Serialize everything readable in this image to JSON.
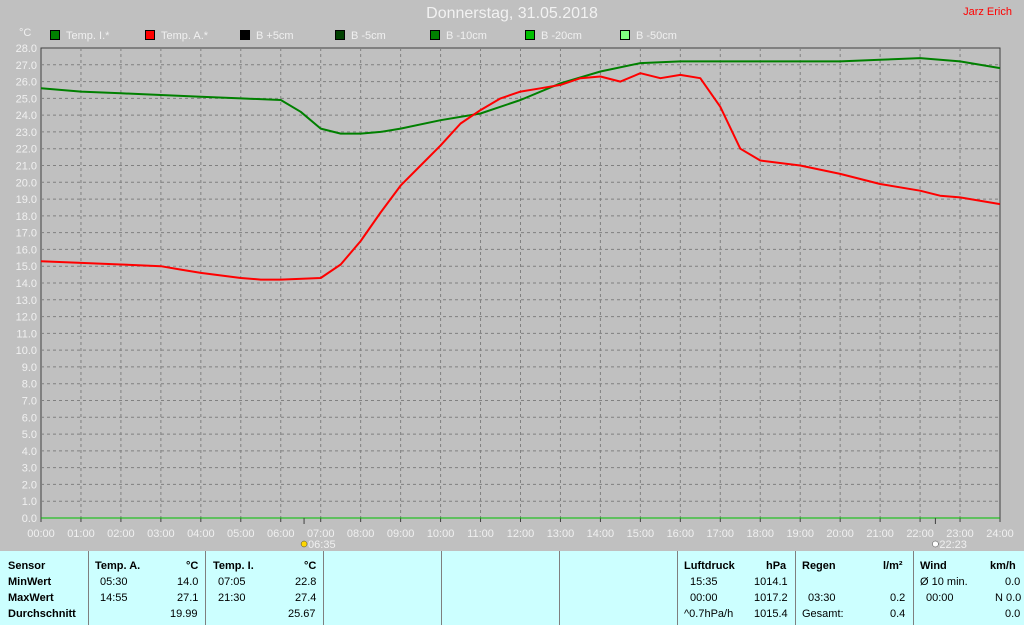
{
  "header": {
    "title": "Donnerstag, 31.05.2018",
    "author": "Jarz Erich",
    "y_unit": "°C"
  },
  "legend": [
    {
      "label": "Temp. I.*",
      "color": "#008000"
    },
    {
      "label": "Temp. A.*",
      "color": "#ff0000"
    },
    {
      "label": "B +5cm",
      "color": "#000000"
    },
    {
      "label": "B -5cm",
      "color": "#004000"
    },
    {
      "label": "B -10cm",
      "color": "#008000"
    },
    {
      "label": "B -20cm",
      "color": "#00c000"
    },
    {
      "label": "B -50cm",
      "color": "#80ff80"
    }
  ],
  "markers": {
    "sunrise": "06:35",
    "sunset": "22:23"
  },
  "colors": {
    "background": "#c0c0c0",
    "table_bg": "#ccffff",
    "grid": "#808080"
  },
  "chart_data": {
    "type": "line",
    "title": "Donnerstag, 31.05.2018",
    "ylabel": "°C",
    "ylim": [
      0,
      28
    ],
    "xlim": [
      0,
      24
    ],
    "grid": true,
    "legend_position": "top",
    "y_ticks": [
      "0.0",
      "1.0",
      "2.0",
      "3.0",
      "4.0",
      "5.0",
      "6.0",
      "7.0",
      "8.0",
      "9.0",
      "10.0",
      "11.0",
      "12.0",
      "13.0",
      "14.0",
      "15.0",
      "16.0",
      "17.0",
      "18.0",
      "19.0",
      "20.0",
      "21.0",
      "22.0",
      "23.0",
      "24.0",
      "25.0",
      "26.0",
      "27.0",
      "28.0"
    ],
    "x_ticks": [
      "00:00",
      "01:00",
      "02:00",
      "03:00",
      "04:00",
      "05:00",
      "06:00",
      "07:00",
      "08:00",
      "09:00",
      "10:00",
      "11:00",
      "12:00",
      "13:00",
      "14:00",
      "15:00",
      "16:00",
      "17:00",
      "18:00",
      "19:00",
      "20:00",
      "21:00",
      "22:00",
      "23:00",
      "24:00"
    ],
    "series": [
      {
        "name": "Temp. I.*",
        "color": "#008000",
        "x": [
          0,
          1,
          2,
          3,
          4,
          5,
          6,
          6.5,
          7,
          7.5,
          8,
          8.5,
          9,
          10,
          11,
          12,
          13,
          14,
          15,
          16,
          17,
          18,
          19,
          20,
          21,
          22,
          23,
          24
        ],
        "y": [
          25.6,
          25.4,
          25.3,
          25.2,
          25.1,
          25.0,
          24.9,
          24.2,
          23.2,
          22.9,
          22.9,
          23.0,
          23.2,
          23.7,
          24.1,
          24.9,
          25.9,
          26.6,
          27.1,
          27.2,
          27.2,
          27.2,
          27.2,
          27.2,
          27.3,
          27.4,
          27.2,
          26.8
        ]
      },
      {
        "name": "Temp. A.*",
        "color": "#ff0000",
        "x": [
          0,
          1,
          2,
          3,
          3.5,
          4,
          5,
          5.5,
          6,
          7,
          7.5,
          8,
          8.5,
          9,
          9.5,
          10,
          10.5,
          11,
          11.5,
          12,
          12.5,
          13,
          13.5,
          14,
          14.5,
          15,
          15.5,
          16,
          16.5,
          17,
          17.5,
          18,
          19,
          20,
          21,
          22,
          22.5,
          23,
          24
        ],
        "y": [
          15.3,
          15.2,
          15.1,
          15.0,
          14.8,
          14.6,
          14.3,
          14.2,
          14.2,
          14.3,
          15.1,
          16.5,
          18.2,
          19.8,
          21.0,
          22.2,
          23.5,
          24.3,
          25.0,
          25.4,
          25.6,
          25.8,
          26.2,
          26.3,
          26.0,
          26.5,
          26.2,
          26.4,
          26.2,
          24.5,
          22.0,
          21.3,
          21.0,
          20.5,
          19.9,
          19.5,
          19.2,
          19.1,
          18.7
        ]
      }
    ]
  },
  "table": {
    "sensor": {
      "label": "Sensor",
      "min": "MinWert",
      "max": "MaxWert",
      "avg": "Durchschnitt"
    },
    "temp_a": {
      "label": "Temp. A.",
      "unit": "°C",
      "min_time": "05:30",
      "min_val": "14.0",
      "max_time": "14:55",
      "max_val": "27.1",
      "avg": "19.99"
    },
    "temp_i": {
      "label": "Temp. I.",
      "unit": "°C",
      "min_time": "07:05",
      "min_val": "22.8",
      "max_time": "21:30",
      "max_val": "27.4",
      "avg": "25.67"
    },
    "pressure": {
      "label": "Luftdruck",
      "unit": "hPa",
      "r1_time": "15:35",
      "r1_val": "1014.1",
      "r2_time": "00:00",
      "r2_val": "1017.2",
      "r3_time": "^0.7hPa/h",
      "r3_val": "1015.4"
    },
    "rain": {
      "label": "Regen",
      "unit": "l/m²",
      "r2_time": "03:30",
      "r2_val": "0.2",
      "r3_label": "Gesamt:",
      "r3_val": "0.4"
    },
    "wind": {
      "label": "Wind",
      "unit": "km/h",
      "r1_label": "Ø 10 min.",
      "r1_val": "0.0",
      "r2_time": "00:00",
      "r2_val": "N 0.0",
      "r3_val": "0.0"
    }
  }
}
